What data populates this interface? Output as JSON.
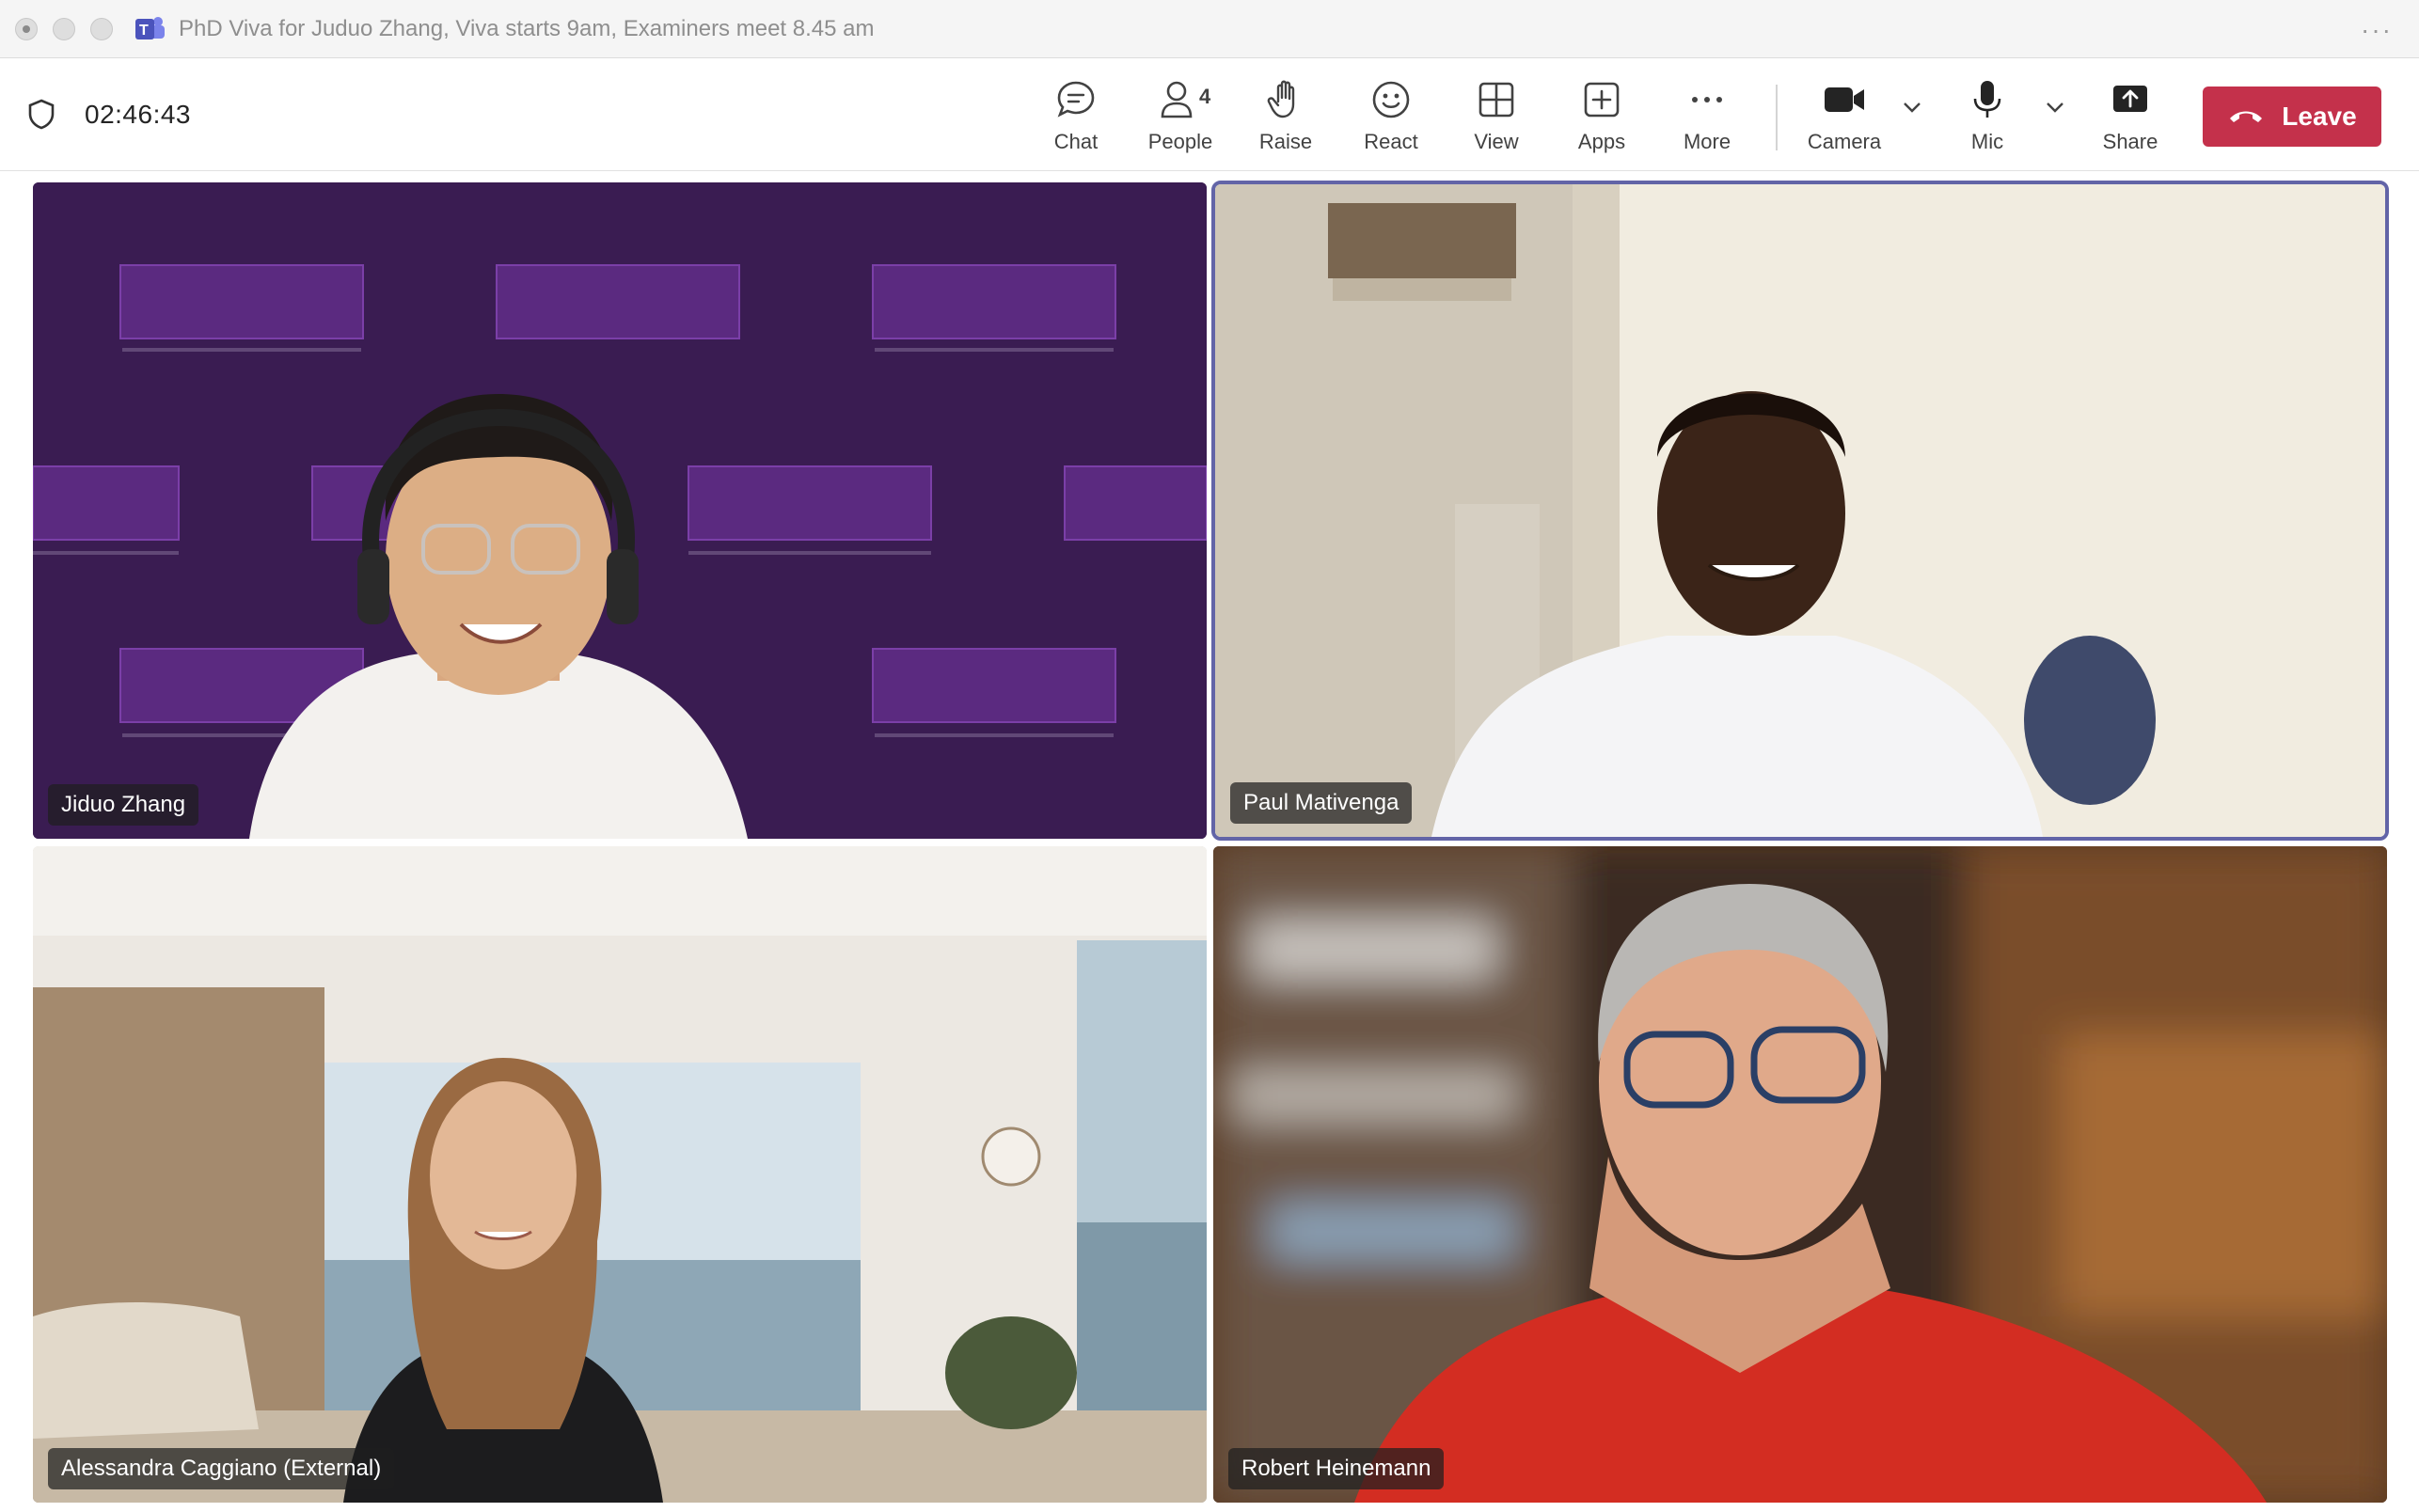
{
  "window": {
    "title": "PhD Viva for Juduo Zhang, Viva starts 9am, Examiners meet 8.45 am"
  },
  "toolbar": {
    "timer": "02:46:43",
    "chat_label": "Chat",
    "people_label": "People",
    "people_count": "4",
    "raise_label": "Raise",
    "react_label": "React",
    "view_label": "View",
    "apps_label": "Apps",
    "more_label": "More",
    "camera_label": "Camera",
    "mic_label": "Mic",
    "share_label": "Share",
    "leave_label": "Leave"
  },
  "participants": [
    {
      "name": "Jiduo Zhang"
    },
    {
      "name": "Paul Mativenga"
    },
    {
      "name": "Alessandra Caggiano (External)"
    },
    {
      "name": "Robert Heinemann"
    }
  ],
  "colors": {
    "accent": "#6264a7",
    "leave": "#c4314b",
    "manchester_purple": "#3a1c52"
  }
}
